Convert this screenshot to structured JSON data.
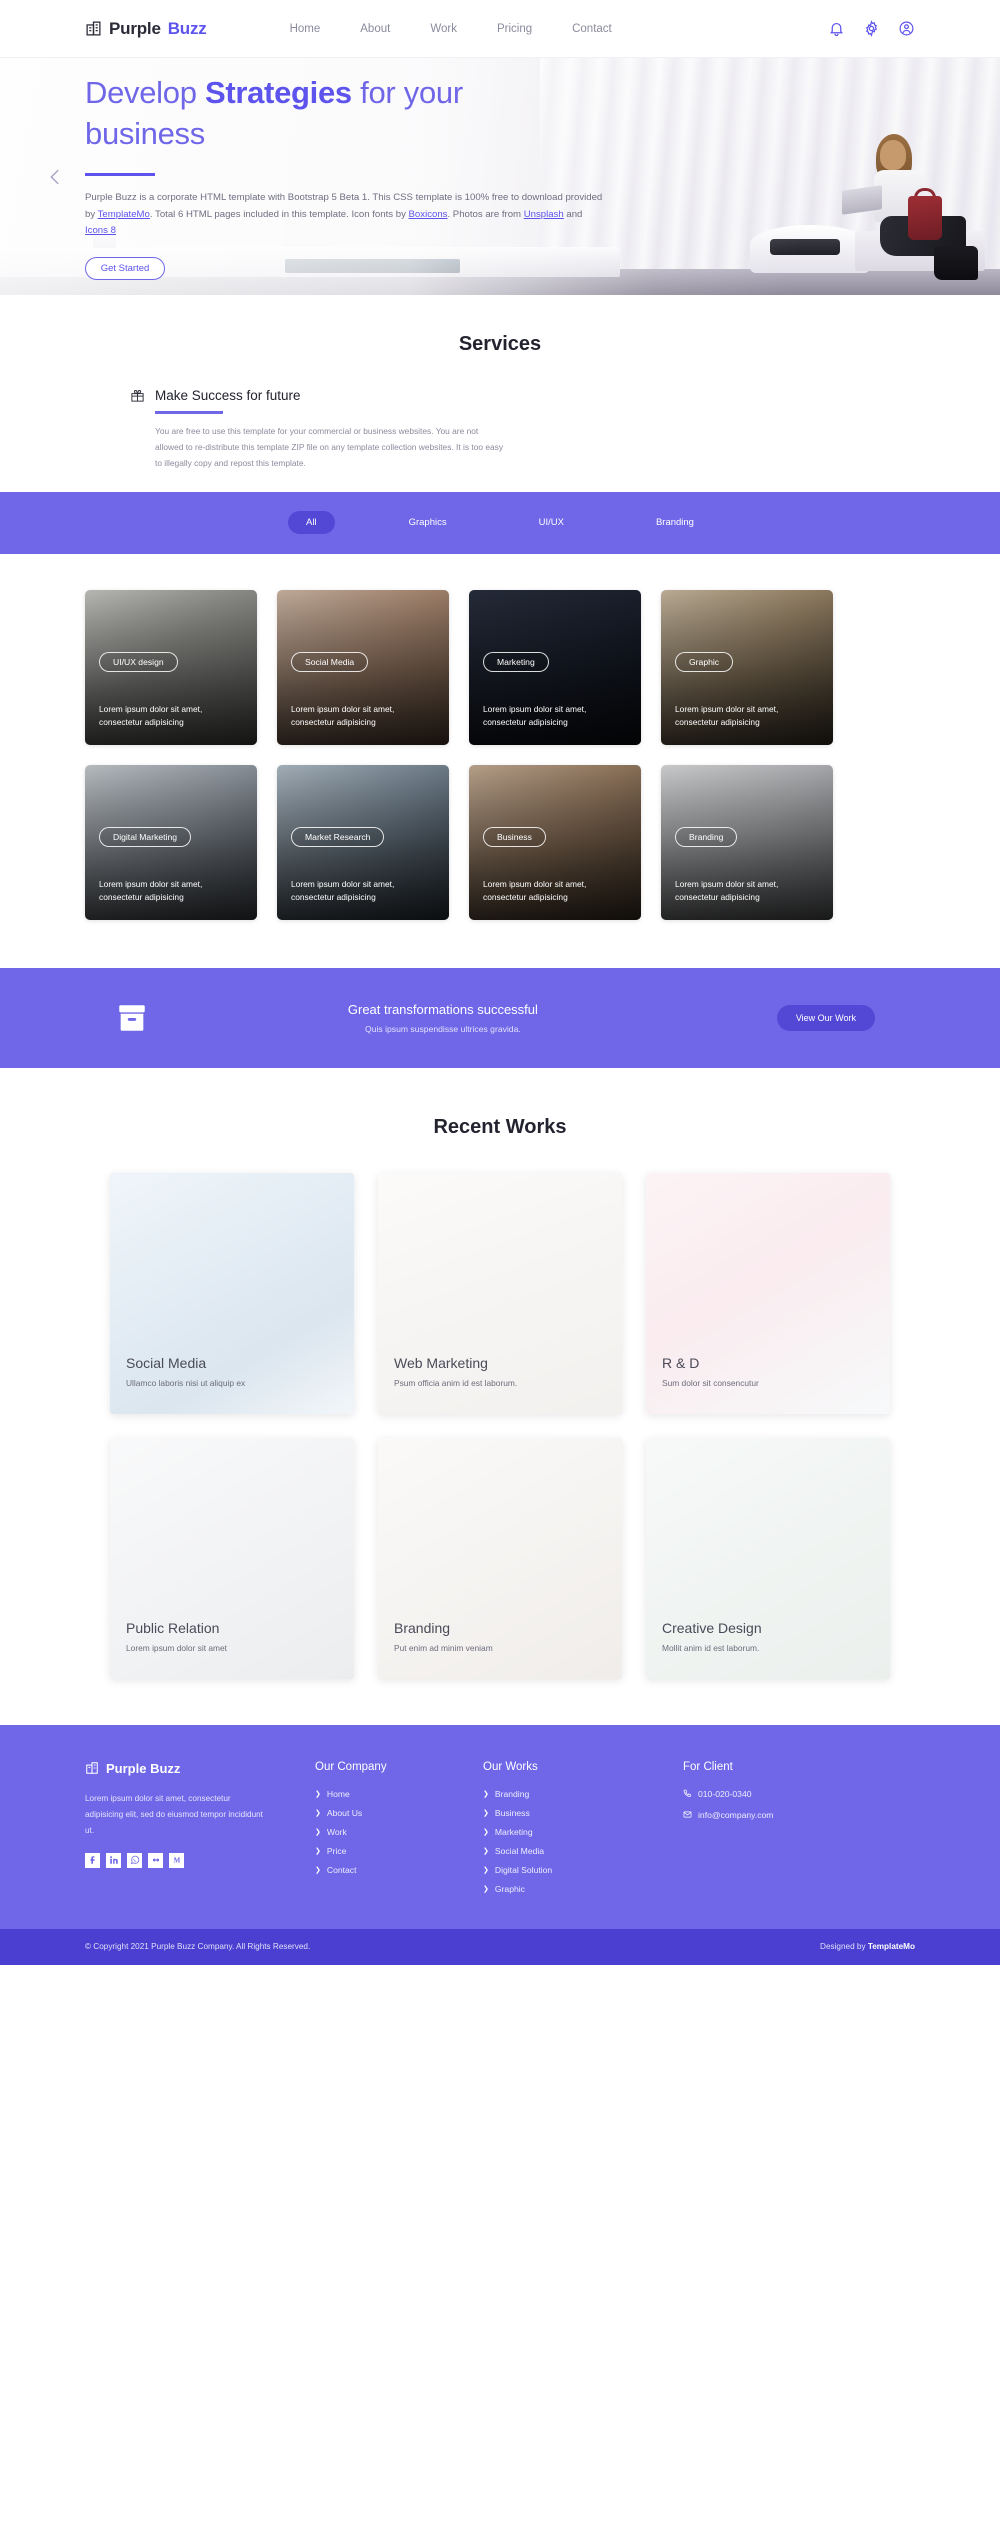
{
  "brand": {
    "name_first": "Purple ",
    "name_accent": "Buzz",
    "icon": "building-icon"
  },
  "nav": {
    "links": [
      {
        "label": "Home",
        "name": "nav-home"
      },
      {
        "label": "About",
        "name": "nav-about"
      },
      {
        "label": "Work",
        "name": "nav-work"
      },
      {
        "label": "Pricing",
        "name": "nav-pricing"
      },
      {
        "label": "Contact",
        "name": "nav-contact"
      }
    ],
    "icons": [
      "bell-icon",
      "gear-icon",
      "user-circle-icon"
    ]
  },
  "hero": {
    "title_pre": "Develop ",
    "title_bold": "Strategies",
    "title_post": " for your business",
    "paragraph_1": "Purple Buzz is a corporate HTML template with Bootstrap 5 Beta 1. This CSS template is 100% free to download provided by ",
    "link_1": "TemplateMo",
    "paragraph_2": ". Total 6 HTML pages included in this template. Icon fonts by ",
    "link_2": "Boxicons",
    "paragraph_3": ". Photos are from ",
    "link_3": "Unsplash",
    "paragraph_4": " and ",
    "link_4": "Icons 8",
    "button": "Get Started",
    "prev_arrow": "chevron-left-icon"
  },
  "services": {
    "title": "Services",
    "item_icon": "gift-icon",
    "item_title": "Make Success for future",
    "item_desc": "You are free to use this template for your commercial or business websites. You are not allowed to re-distribute this template ZIP file on any template collection websites. It is too easy to illegally copy and repost this template."
  },
  "filters": [
    {
      "label": "All",
      "active": true
    },
    {
      "label": "Graphics",
      "active": false
    },
    {
      "label": "UI/UX",
      "active": false
    },
    {
      "label": "Branding",
      "active": false
    }
  ],
  "projects": {
    "desc": "Lorem ipsum dolor sit amet, consectetur adipisicing",
    "row1": [
      {
        "tag": "UI/UX design",
        "img": "ph-a"
      },
      {
        "tag": "Social Media",
        "img": "ph-b"
      },
      {
        "tag": "Marketing",
        "img": "ph-c"
      },
      {
        "tag": "Graphic",
        "img": "ph-d"
      }
    ],
    "row2": [
      {
        "tag": "Digital Marketing",
        "img": "ph-e"
      },
      {
        "tag": "Market Research",
        "img": "ph-f"
      },
      {
        "tag": "Business",
        "img": "ph-g"
      },
      {
        "tag": "Branding",
        "img": "ph-h"
      }
    ]
  },
  "cta": {
    "icon": "archive-box-icon",
    "title": "Great transformations successful",
    "subtitle": "Quis ipsum suspendisse ultrices gravida.",
    "button": "View Our Work"
  },
  "works": {
    "title": "Recent Works",
    "items": [
      {
        "title": "Social Media",
        "sub": "Ullamco laboris nisi ut aliquip ex",
        "img": "wi-1"
      },
      {
        "title": "Web Marketing",
        "sub": "Psum officia anim id est laborum.",
        "img": "wi-2"
      },
      {
        "title": "R & D",
        "sub": "Sum dolor sit consencutur",
        "img": "wi-3"
      },
      {
        "title": "Public Relation",
        "sub": "Lorem ipsum dolor sit amet",
        "img": "wi-4"
      },
      {
        "title": "Branding",
        "sub": "Put enim ad minim veniam",
        "img": "wi-5"
      },
      {
        "title": "Creative Design",
        "sub": "Mollit anim id est laborum.",
        "img": "wi-6"
      }
    ]
  },
  "footer": {
    "brand_name": "Purple Buzz",
    "about": "Lorem ipsum dolor sit amet, consectetur adipisicing elit, sed do eiusmod tempor incididunt ut.",
    "socials": [
      "facebook-icon",
      "linkedin-icon",
      "whatsapp-icon",
      "flickr-icon",
      "medium-icon"
    ],
    "company": {
      "title": "Our Company",
      "links": [
        "Home",
        "About Us",
        "Work",
        "Price",
        "Contact"
      ]
    },
    "works": {
      "title": "Our Works",
      "links": [
        "Branding",
        "Business",
        "Marketing",
        "Social Media",
        "Digital Solution",
        "Graphic"
      ]
    },
    "client": {
      "title": "For Client",
      "phone": "010-020-0340",
      "email": "info@company.com",
      "phone_icon": "phone-icon",
      "email_icon": "envelope-icon"
    }
  },
  "copyright": {
    "left": "© Copyright 2021 Purple Buzz Company. All Rights Reserved.",
    "right_pre": "Designed by ",
    "right_bold": "TemplateMo"
  },
  "colors": {
    "accent": "#6f67e8",
    "accent_dark": "#5348d6",
    "footer_bottom": "#4a3fd0"
  }
}
